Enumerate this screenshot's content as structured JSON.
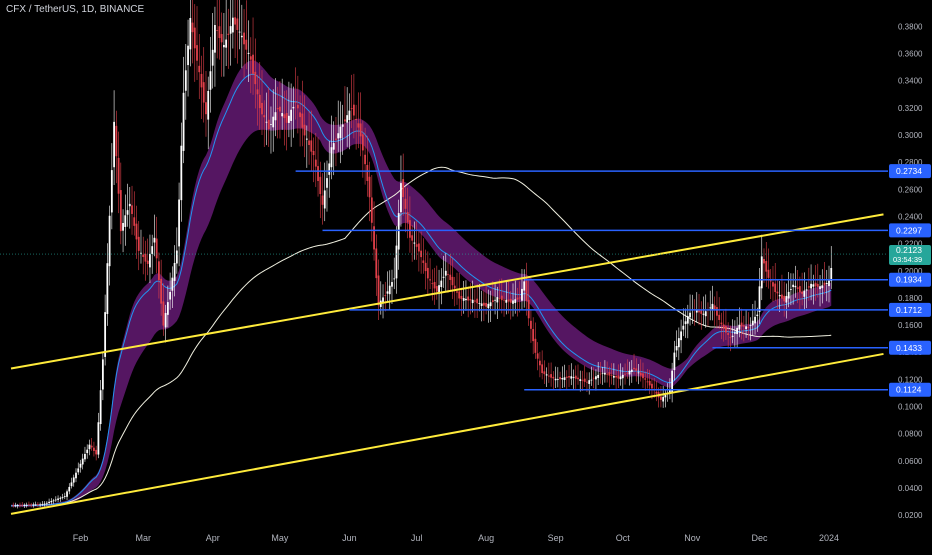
{
  "header": {
    "symbol": "CFX / TetherUS, 1D, BINANCE"
  },
  "chart_data": {
    "type": "candlestick",
    "y_axis_ticks": [
      "0.3800",
      "0.3600",
      "0.3400",
      "0.3200",
      "0.3000",
      "0.2800",
      "0.2600",
      "0.2400",
      "0.2200",
      "0.2000",
      "0.1800",
      "0.1600",
      "0.1400",
      "0.1200",
      "0.1000",
      "0.0800",
      "0.0600",
      "0.0400",
      "0.0200"
    ],
    "x_axis_ticks": [
      "Feb",
      "Mar",
      "Apr",
      "May",
      "Jun",
      "Jul",
      "Aug",
      "Sep",
      "Oct",
      "Nov",
      "Dec",
      "2024"
    ],
    "ylim": [
      0.015,
      0.392
    ],
    "price_levels": [
      {
        "value": 0.2734,
        "label": "0.2734",
        "from": "2023-05-08"
      },
      {
        "value": 0.2297,
        "label": "0.2297",
        "from": "2023-05-20"
      },
      {
        "value": 0.1934,
        "label": "0.1934",
        "from": "2023-08-18"
      },
      {
        "value": 0.1712,
        "label": "0.1712",
        "from": "2023-06-01"
      },
      {
        "value": 0.1433,
        "label": "0.1433",
        "from": "2023-11-10"
      },
      {
        "value": 0.1124,
        "label": "0.1124",
        "from": "2023-08-18"
      }
    ],
    "current_price": {
      "value": 0.2123,
      "label": "0.2123",
      "countdown": "03:54:39"
    },
    "trendlines": [
      {
        "name": "upper",
        "points": [
          [
            "2023-01-01",
            0.128
          ],
          [
            "2024-01-03",
            0.235
          ]
        ]
      },
      {
        "name": "lower",
        "points": [
          [
            "2023-01-01",
            0.021
          ],
          [
            "2024-01-03",
            0.132
          ]
        ]
      }
    ],
    "price_path": [
      [
        "2023-01-01",
        0.027
      ],
      [
        "2023-01-15",
        0.028
      ],
      [
        "2023-01-25",
        0.034
      ],
      [
        "2023-02-01",
        0.058
      ],
      [
        "2023-02-05",
        0.072
      ],
      [
        "2023-02-08",
        0.065
      ],
      [
        "2023-02-11",
        0.135
      ],
      [
        "2023-02-13",
        0.205
      ],
      [
        "2023-02-16",
        0.31
      ],
      [
        "2023-02-19",
        0.23
      ],
      [
        "2023-02-23",
        0.25
      ],
      [
        "2023-02-27",
        0.215
      ],
      [
        "2023-03-03",
        0.205
      ],
      [
        "2023-03-06",
        0.225
      ],
      [
        "2023-03-10",
        0.16
      ],
      [
        "2023-03-13",
        0.185
      ],
      [
        "2023-03-16",
        0.215
      ],
      [
        "2023-03-19",
        0.33
      ],
      [
        "2023-03-22",
        0.385
      ],
      [
        "2023-03-26",
        0.345
      ],
      [
        "2023-03-29",
        0.315
      ],
      [
        "2023-04-02",
        0.38
      ],
      [
        "2023-04-06",
        0.365
      ],
      [
        "2023-04-10",
        0.385
      ],
      [
        "2023-04-14",
        0.372
      ],
      [
        "2023-04-18",
        0.355
      ],
      [
        "2023-04-22",
        0.32
      ],
      [
        "2023-04-26",
        0.305
      ],
      [
        "2023-04-30",
        0.32
      ],
      [
        "2023-05-04",
        0.31
      ],
      [
        "2023-05-08",
        0.325
      ],
      [
        "2023-05-12",
        0.3
      ],
      [
        "2023-05-16",
        0.285
      ],
      [
        "2023-05-20",
        0.248
      ],
      [
        "2023-05-24",
        0.29
      ],
      [
        "2023-05-28",
        0.305
      ],
      [
        "2023-06-02",
        0.32
      ],
      [
        "2023-06-06",
        0.3
      ],
      [
        "2023-06-10",
        0.255
      ],
      [
        "2023-06-14",
        0.175
      ],
      [
        "2023-06-18",
        0.185
      ],
      [
        "2023-06-21",
        0.195
      ],
      [
        "2023-06-24",
        0.265
      ],
      [
        "2023-06-28",
        0.225
      ],
      [
        "2023-07-02",
        0.215
      ],
      [
        "2023-07-06",
        0.195
      ],
      [
        "2023-07-10",
        0.185
      ],
      [
        "2023-07-14",
        0.2
      ],
      [
        "2023-07-20",
        0.18
      ],
      [
        "2023-07-26",
        0.178
      ],
      [
        "2023-08-01",
        0.174
      ],
      [
        "2023-08-06",
        0.18
      ],
      [
        "2023-08-12",
        0.177
      ],
      [
        "2023-08-16",
        0.18
      ],
      [
        "2023-08-18",
        0.192
      ],
      [
        "2023-08-20",
        0.165
      ],
      [
        "2023-08-23",
        0.14
      ],
      [
        "2023-08-26",
        0.125
      ],
      [
        "2023-09-01",
        0.12
      ],
      [
        "2023-09-08",
        0.122
      ],
      [
        "2023-09-15",
        0.118
      ],
      [
        "2023-09-22",
        0.125
      ],
      [
        "2023-09-29",
        0.121
      ],
      [
        "2023-10-06",
        0.128
      ],
      [
        "2023-10-12",
        0.118
      ],
      [
        "2023-10-18",
        0.105
      ],
      [
        "2023-10-22",
        0.112
      ],
      [
        "2023-10-24",
        0.14
      ],
      [
        "2023-10-28",
        0.16
      ],
      [
        "2023-11-01",
        0.172
      ],
      [
        "2023-11-06",
        0.168
      ],
      [
        "2023-11-10",
        0.175
      ],
      [
        "2023-11-14",
        0.16
      ],
      [
        "2023-11-18",
        0.15
      ],
      [
        "2023-11-22",
        0.16
      ],
      [
        "2023-11-26",
        0.158
      ],
      [
        "2023-11-30",
        0.168
      ],
      [
        "2023-12-02",
        0.21
      ],
      [
        "2023-12-05",
        0.195
      ],
      [
        "2023-12-08",
        0.185
      ],
      [
        "2023-12-12",
        0.178
      ],
      [
        "2023-12-16",
        0.19
      ],
      [
        "2023-12-20",
        0.183
      ],
      [
        "2023-12-24",
        0.19
      ],
      [
        "2023-12-28",
        0.188
      ],
      [
        "2024-01-01",
        0.192
      ],
      [
        "2024-01-03",
        0.2123
      ]
    ]
  },
  "colors": {
    "background": "#000000",
    "level_line": "#2962ff",
    "trendline": "#ffeb3b",
    "band_fill": "#6a1b7a",
    "ema_line": "#2196f3",
    "sma_line": "#f0f0e0",
    "candle_up": "#ffffff",
    "candle_down": "#e2404a",
    "label_bg": "#2962ff",
    "current_bg": "#26a69a",
    "axis_text": "#b2b5be",
    "level_label_text": "#ffffff"
  }
}
